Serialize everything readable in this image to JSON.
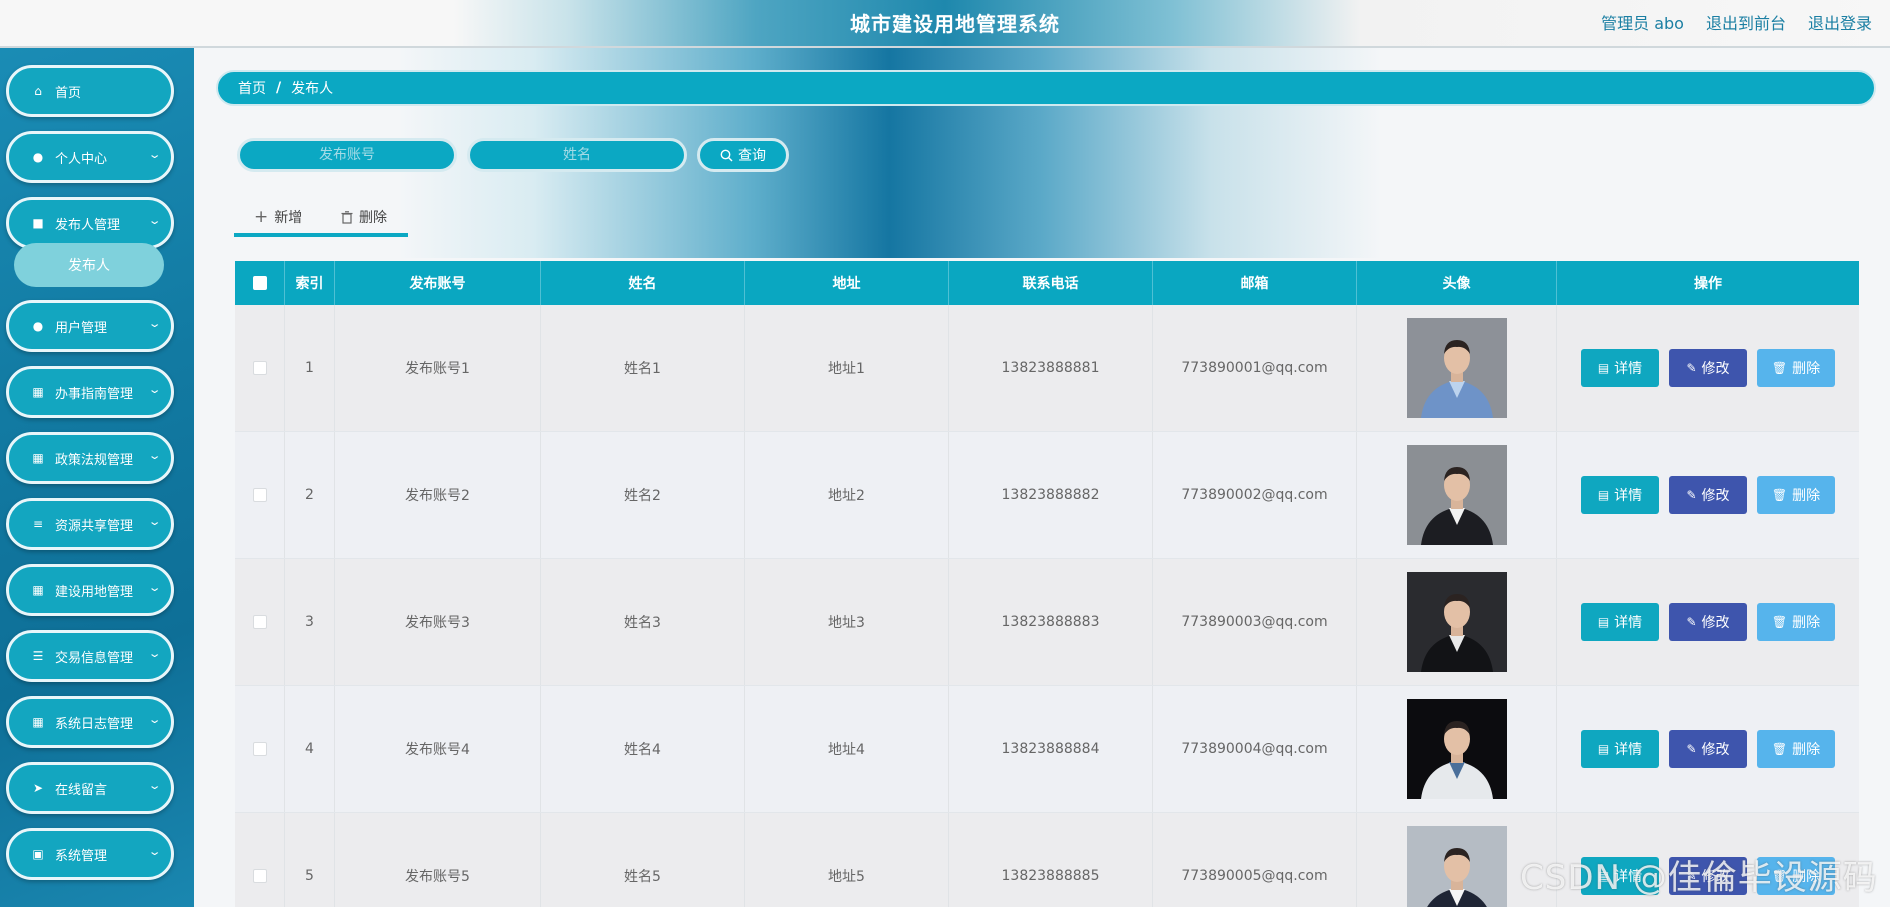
{
  "header": {
    "title": "城市建设用地管理系统",
    "links": [
      "管理员 abo",
      "退出到前台",
      "退出登录"
    ]
  },
  "sidebar": {
    "items": [
      {
        "label": "首页",
        "icon": "home-icon",
        "expandable": false
      },
      {
        "label": "个人中心",
        "icon": "user-icon",
        "expandable": true
      },
      {
        "label": "发布人管理",
        "icon": "publisher-icon",
        "expandable": true
      },
      {
        "label": "用户管理",
        "icon": "user-icon",
        "expandable": true
      },
      {
        "label": "办事指南管理",
        "icon": "grid-icon",
        "expandable": true
      },
      {
        "label": "政策法规管理",
        "icon": "grid-icon",
        "expandable": true
      },
      {
        "label": "资源共享管理",
        "icon": "list-icon",
        "expandable": true
      },
      {
        "label": "建设用地管理",
        "icon": "grid-icon",
        "expandable": true
      },
      {
        "label": "交易信息管理",
        "icon": "sliders-icon",
        "expandable": true
      },
      {
        "label": "系统日志管理",
        "icon": "grid-icon",
        "expandable": true
      },
      {
        "label": "在线留言",
        "icon": "send-icon",
        "expandable": true
      },
      {
        "label": "系统管理",
        "icon": "clipboard-icon",
        "expandable": true
      }
    ],
    "submenu_item": "发布人"
  },
  "breadcrumb": {
    "home": "首页",
    "sep": "/",
    "current": "发布人"
  },
  "search": {
    "account_placeholder": "发布账号",
    "name_placeholder": "姓名",
    "button_label": "查询"
  },
  "toolbar": {
    "add_label": "新增",
    "delete_label": "删除"
  },
  "table": {
    "headers": [
      "索引",
      "发布账号",
      "姓名",
      "地址",
      "联系电话",
      "邮箱",
      "头像",
      "操作"
    ],
    "rows": [
      {
        "index": "1",
        "account": "发布账号1",
        "name": "姓名1",
        "address": "地址1",
        "phone": "13823888881",
        "email": "773890001@qq.com"
      },
      {
        "index": "2",
        "account": "发布账号2",
        "name": "姓名2",
        "address": "地址2",
        "phone": "13823888882",
        "email": "773890002@qq.com"
      },
      {
        "index": "3",
        "account": "发布账号3",
        "name": "姓名3",
        "address": "地址3",
        "phone": "13823888883",
        "email": "773890003@qq.com"
      },
      {
        "index": "4",
        "account": "发布账号4",
        "name": "姓名4",
        "address": "地址4",
        "phone": "13823888884",
        "email": "773890004@qq.com"
      },
      {
        "index": "5",
        "account": "发布账号5",
        "name": "姓名5",
        "address": "地址5",
        "phone": "13823888885",
        "email": "773890005@qq.com"
      }
    ],
    "actions": {
      "detail": "详情",
      "edit": "修改",
      "delete": "删除"
    }
  },
  "watermark": "CSDN @佳倫毕设源码",
  "colors": {
    "primary": "#0ba8c3",
    "edit": "#3e55ad",
    "delete": "#56b4ec"
  }
}
